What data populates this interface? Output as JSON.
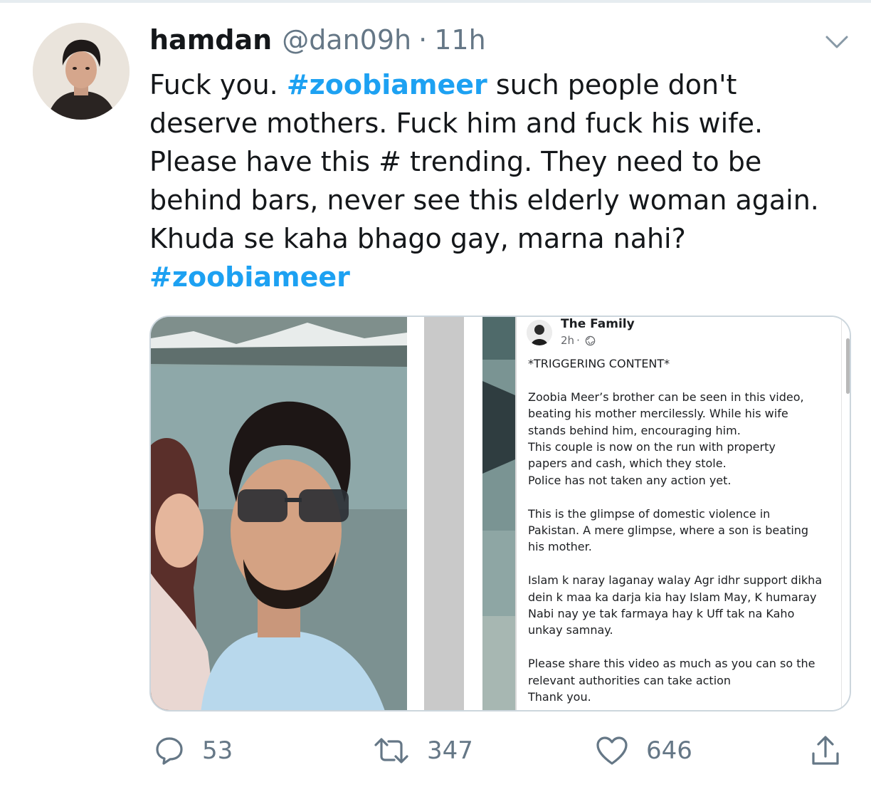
{
  "tweet": {
    "display_name": "hamdan",
    "handle": "@dan09h",
    "separator": "·",
    "time": "11h",
    "text_lines": [
      {
        "pre": "Fuck you. ",
        "tag": "#zoobiameer",
        "post": " such people don't"
      },
      "deserve mothers. Fuck him and fuck his wife.",
      "Please have this # trending. They need to be",
      "behind bars, never see this elderly woman again.",
      "Khuda se kaha bhago gay, marna nahi?"
    ],
    "trailing_hashtag": "#zoobiameer"
  },
  "embedded_post": {
    "author": "The Family",
    "time": "2h",
    "separator": "·",
    "lines": [
      "*TRIGGERING CONTENT*",
      "",
      "Zoobia Meer’s brother can be seen in this video,",
      "beating his mother mercilessly. While his wife",
      "stands behind him, encouraging him.",
      "This couple is now on the run with property",
      "papers and cash, which they stole.",
      "Police has not taken any action yet.",
      "",
      "This is the glimpse of domestic violence in",
      "Pakistan. A mere glimpse, where a son is beating",
      "his mother.",
      "",
      "Islam k naray laganay walay Agr idhr support dikha",
      "dein k maa ka darja kia hay Islam May, K humaray",
      "Nabi nay ye tak farmaya hay k Uff tak na Kaho",
      "unkay samnay.",
      "",
      "Please share this video as much as you can so the",
      "relevant authorities can take action",
      "Thank you."
    ]
  },
  "actions": {
    "reply_count": "53",
    "retweet_count": "347",
    "like_count": "646"
  },
  "icons": {
    "reply": "reply-icon",
    "retweet": "retweet-icon",
    "like": "heart-icon",
    "share": "share-icon",
    "more": "chevron-down-icon",
    "privacy": "globe-icon"
  },
  "colors": {
    "hashtag": "#1da1f2",
    "secondary_text": "#657786",
    "border": "#ccd6dd"
  }
}
